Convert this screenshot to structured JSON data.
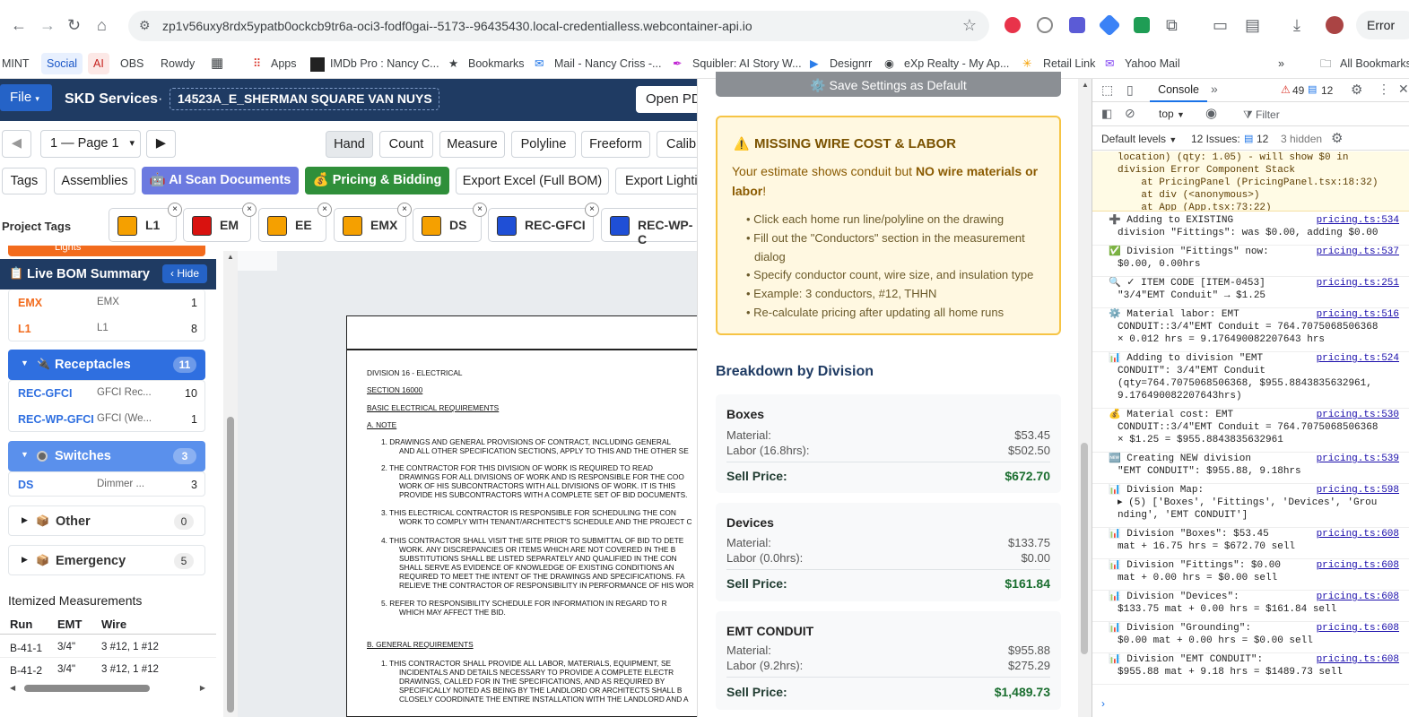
{
  "browser": {
    "url": "zp1v56uxy8rdx5ypatb0ockcb9tr6a-oci3-fodf0gai--5173--96435430.local-credentialless.webcontainer-api.io",
    "profile_label": "Error",
    "bookmarks": [
      "MINT",
      "Social",
      "AI",
      "OBS",
      "Rowdy",
      "Apps",
      "IMDb Pro : Nancy C...",
      "Bookmarks",
      "Mail - Nancy Criss -...",
      "Squibler: AI Story W...",
      "Designrr",
      "eXp Realty - My Ap...",
      "Retail Link",
      "Yahoo Mail",
      "All Bookmarks"
    ]
  },
  "app": {
    "file_label": "File",
    "title": "SKD Services",
    "separator": "·",
    "job_name": "14523A_E_SHERMAN SQUARE VAN NUYS",
    "open_pdf_label": "Open PD",
    "page_select": "1 — Page 1",
    "tools": [
      "Hand",
      "Count",
      "Measure",
      "Polyline",
      "Freeform",
      "Calib"
    ],
    "actions": [
      "Tags",
      "Assemblies",
      "AI Scan Documents",
      "Pricing & Bidding",
      "Export Excel (Full BOM)",
      "Export Lighti"
    ],
    "project_tags_label": "Project Tags",
    "tags": [
      {
        "label": "L1",
        "color": "#f5a000"
      },
      {
        "label": "EM",
        "color": "#d9120f"
      },
      {
        "label": "EE",
        "color": "#f5a000"
      },
      {
        "label": "EMX",
        "color": "#f5a000"
      },
      {
        "label": "DS",
        "color": "#f5a000"
      },
      {
        "label": "REC-GFCI",
        "color": "#1f4fd6"
      },
      {
        "label": "REC-WP-C",
        "color": "#1f4fd6"
      }
    ]
  },
  "bom": {
    "title": "Live BOM Summary",
    "hide_label": "‹ Hide",
    "top_partial": "Lights",
    "lights_items": [
      {
        "code": "EMX",
        "desc": "EMX",
        "qty": "1"
      },
      {
        "code": "L1",
        "desc": "L1",
        "qty": "8"
      }
    ],
    "receptacles": {
      "name": "Receptacles",
      "count": "11",
      "items": [
        {
          "code": "REC-GFCI",
          "desc": "GFCI Rec...",
          "qty": "10"
        },
        {
          "code": "REC-WP-GFCI",
          "desc": "GFCI (We...",
          "qty": "1"
        }
      ]
    },
    "switches": {
      "name": "Switches",
      "count": "3",
      "items": [
        {
          "code": "DS",
          "desc": "Dimmer ...",
          "qty": "3"
        }
      ]
    },
    "other": {
      "name": "Other",
      "count": "0"
    },
    "emergency": {
      "name": "Emergency",
      "count": "5"
    },
    "itemized_title": "Itemized Measurements",
    "columns": [
      "Run",
      "EMT",
      "Wire"
    ],
    "rows": [
      [
        "B-41-1",
        "3/4\"",
        "3 #12, 1 #12"
      ],
      [
        "B-41-2",
        "3/4\"",
        "3 #12, 1 #12"
      ]
    ]
  },
  "document": {
    "lines": [
      "DIVISION 16 - ELECTRICAL",
      "SECTION 16000",
      "BASIC ELECTRICAL REQUIREMENTS",
      "A.   NOTE",
      "1.     DRAWINGS AND GENERAL PROVISIONS OF CONTRACT, INCLUDING GENERAL",
      "AND ALL OTHER SPECIFICATION SECTIONS, APPLY TO THIS AND THE OTHER SE",
      "2.     THE CONTRACTOR FOR THIS DIVISION OF WORK IS REQUIRED TO READ",
      "DRAWINGS FOR ALL DIVISIONS OF WORK AND IS RESPONSIBLE FOR THE COO",
      "WORK OF HIS SUBCONTRACTORS WITH ALL DIVISIONS OF WORK. IT IS THIS",
      "PROVIDE HIS SUBCONTRACTORS WITH A COMPLETE SET OF BID DOCUMENTS.",
      "3.     THIS ELECTRICAL CONTRACTOR IS RESPONSIBLE FOR SCHEDULING THE CON",
      "WORK TO COMPLY WITH TENANT/ARCHITECT'S SCHEDULE AND THE PROJECT C",
      "4.     THIS CONTRACTOR SHALL VISIT THE SITE PRIOR TO SUBMITTAL OF BID TO DETE",
      "WORK.  ANY DISCREPANCIES OR ITEMS WHICH ARE NOT COVERED IN THE B",
      "SUBSTITUTIONS SHALL BE LISTED SEPARATELY AND QUALIFIED IN THE CON",
      "SHALL SERVE AS EVIDENCE OF KNOWLEDGE OF EXISTING CONDITIONS AN",
      "REQUIRED TO MEET THE INTENT OF THE DRAWINGS AND SPECIFICATIONS.  FA",
      "RELIEVE THE CONTRACTOR OF RESPONSIBILITY IN PERFORMANCE OF HIS WOR",
      "5.     REFER TO RESPONSIBILITY SCHEDULE FOR INFORMATION IN REGARD TO R",
      "WHICH MAY AFFECT THE BID.",
      "B.   GENERAL REQUIREMENTS",
      "1.     THIS CONTRACTOR SHALL PROVIDE ALL LABOR, MATERIALS, EQUIPMENT, SE",
      "INCIDENTALS AND DETAILS NECESSARY TO PROVIDE A COMPLETE ELECTR",
      "DRAWINGS, CALLED FOR IN THE SPECIFICATIONS, AND AS REQUIRED BY",
      "SPECIFICALLY NOTED AS BEING BY THE LANDLORD OR ARCHITECTS SHALL B",
      "CLOSELY COORDINATE THE ENTIRE INSTALLATION WITH THE LANDLORD AND A"
    ]
  },
  "pricing": {
    "save_default_label": "⚙️ Save Settings as Default",
    "warning": {
      "title": "MISSING WIRE COST & LABOR",
      "text_pre": "Your estimate shows conduit but ",
      "text_bold": "NO wire materials or labor",
      "text_post": "!",
      "bullets": [
        "Click each home run line/polyline on the drawing",
        "Fill out the \"Conductors\" section in the measurement",
        "dialog",
        "Specify conductor count, wire size, and insulation type",
        "Example: 3 conductors, #12, THHN",
        "Re-calculate pricing after updating all home runs"
      ]
    },
    "breakdown_title": "Breakdown by Division",
    "divisions": [
      {
        "name": "Boxes",
        "material_label": "Material:",
        "material": "$53.45",
        "labor_label": "Labor (16.8hrs):",
        "labor": "$502.50",
        "sell_label": "Sell Price:",
        "sell": "$672.70"
      },
      {
        "name": "Devices",
        "material_label": "Material:",
        "material": "$133.75",
        "labor_label": "Labor (0.0hrs):",
        "labor": "$0.00",
        "sell_label": "Sell Price:",
        "sell": "$161.84"
      },
      {
        "name": "EMT CONDUIT",
        "material_label": "Material:",
        "material": "$955.88",
        "labor_label": "Labor (9.2hrs):",
        "labor": "$275.29",
        "sell_label": "Sell Price:",
        "sell": "$1,489.73"
      }
    ]
  },
  "devtools": {
    "tab_console": "Console",
    "errors": "49",
    "messages": "12",
    "context": "top",
    "filter_placeholder": "Filter",
    "levels": "Default levels",
    "issues_label": "12 Issues:",
    "issues_count": "12",
    "hidden": "3 hidden",
    "error_block": [
      "location) (qty: 1.05) - will show $0 in",
      "division Error Component Stack",
      "    at PricingPanel (PricingPanel.tsx:18:32)",
      "    at div (<anonymous>)",
      "    at App (App.tsx:73:22)"
    ],
    "logs": [
      {
        "text": [
          "➕ Adding to EXISTING",
          "division \"Fittings\": was $0.00, adding $0.00"
        ],
        "src": "pricing.ts:534"
      },
      {
        "text": [
          "✅ Division \"Fittings\" now:",
          "$0.00, 0.00hrs"
        ],
        "src": "pricing.ts:537"
      },
      {
        "text": [
          "🔍 ✓ ITEM CODE [ITEM-0453]",
          "\"3/4\"EMT Conduit\" → $1.25"
        ],
        "src": "pricing.ts:251"
      },
      {
        "text": [
          "⚙️ Material labor: EMT",
          "CONDUIT::3/4\"EMT Conduit = 764.7075068506368",
          "× 0.012 hrs = 9.176490082207643 hrs"
        ],
        "src": "pricing.ts:516"
      },
      {
        "text": [
          "📊 Adding to division \"EMT",
          "CONDUIT\": 3/4\"EMT Conduit",
          "(qty=764.7075068506368, $955.8843835632961,",
          "9.176490082207643hrs)"
        ],
        "src": "pricing.ts:524"
      },
      {
        "text": [
          "💰 Material cost: EMT",
          "CONDUIT::3/4\"EMT Conduit = 764.7075068506368",
          "× $1.25 = $955.8843835632961"
        ],
        "src": "pricing.ts:530"
      },
      {
        "text": [
          "🆕 Creating NEW division",
          "\"EMT CONDUIT\": $955.88, 9.18hrs"
        ],
        "src": "pricing.ts:539"
      },
      {
        "text": [
          "📊 Division Map:",
          "▸ (5) ['Boxes', 'Fittings', 'Devices', 'Grou",
          "nding', 'EMT CONDUIT']"
        ],
        "src": "pricing.ts:598"
      },
      {
        "text": [
          "📊 Division \"Boxes\": $53.45",
          "mat + 16.75 hrs = $672.70 sell"
        ],
        "src": "pricing.ts:608"
      },
      {
        "text": [
          "📊 Division \"Fittings\": $0.00",
          "mat + 0.00 hrs = $0.00 sell"
        ],
        "src": "pricing.ts:608"
      },
      {
        "text": [
          "📊 Division \"Devices\":",
          "$133.75 mat + 0.00 hrs = $161.84 sell"
        ],
        "src": "pricing.ts:608"
      },
      {
        "text": [
          "📊 Division \"Grounding\":",
          "$0.00 mat + 0.00 hrs = $0.00 sell"
        ],
        "src": "pricing.ts:608"
      },
      {
        "text": [
          "📊 Division \"EMT CONDUIT\":",
          "$955.88 mat + 9.18 hrs = $1489.73 sell"
        ],
        "src": "pricing.ts:608"
      }
    ]
  }
}
